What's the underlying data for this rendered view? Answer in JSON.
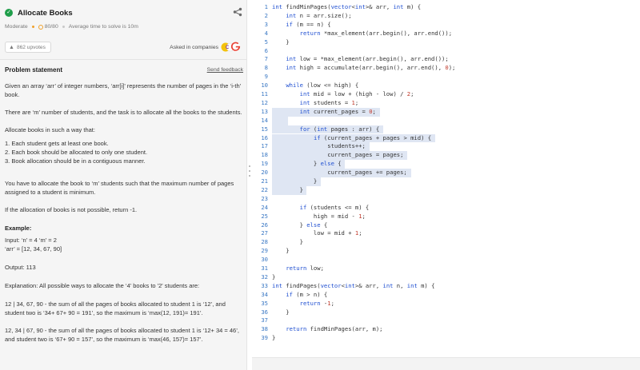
{
  "problem": {
    "title": "Allocate Books",
    "difficulty": "Moderate",
    "score": "80/80",
    "avg_time": "Average time to solve is 10m",
    "upvotes": "862 upvotes",
    "asked_in": "Asked in companies",
    "section_title": "Problem statement",
    "feedback": "Send feedback",
    "statement": [
      "Given an array ‘arr’ of integer numbers, ‘arr[i]’ represents the number of pages in the ‘i-th’ book.",
      "There are ‘m’ number of students, and the task is to allocate all the books to the students.",
      "Allocate books in such a way that:",
      "1. Each student gets at least one book.",
      "2. Each book should be allocated to only one student.",
      "3. Book allocation should be in a contiguous manner.",
      "You have to allocate the book to ‘m’ students such that the maximum number of pages assigned to a student is minimum.",
      "If the allocation of books is not possible, return -1.",
      "Example:",
      "Input: ‘n’ = 4 ‘m’ = 2",
      "‘arr’ = [12, 34, 67, 90]",
      "Output: 113",
      "Explanation: All possible ways to allocate the ‘4’ books to '2' students are:",
      "12 | 34, 67, 90 - the sum of all the pages of books allocated to student 1 is ‘12’, and student two is ‘34+ 67+ 90 = 191’, so the maximum is ‘max(12, 191)= 191’.",
      "12, 34 | 67, 90 - the sum of all the pages of books allocated to student 1 is ‘12+ 34 = 46’, and student two is ‘67+ 90 = 157’, so the maximum is ‘max(46, 157)= 157’."
    ]
  },
  "editor": {
    "lines": [
      "int findMinPages(vector<int>& arr, int m) {",
      "    int n = arr.size();",
      "    if (m == n) {",
      "        return *max_element(arr.begin(), arr.end());",
      "    }",
      "",
      "    int low = *max_element(arr.begin(), arr.end());",
      "    int high = accumulate(arr.begin(), arr.end(), 0);",
      "",
      "    while (low <= high) {",
      "        int mid = low + (high - low) / 2;",
      "        int students = 1;",
      "        int current_pages = 0;",
      "",
      "        for (int pages : arr) {",
      "            if (current_pages + pages > mid) {",
      "                students++;",
      "                current_pages = pages;",
      "            } else {",
      "                current_pages += pages;",
      "            }",
      "        }",
      "",
      "        if (students <= m) {",
      "            high = mid - 1;",
      "        } else {",
      "            low = mid + 1;",
      "        }",
      "    }",
      "",
      "    return low;",
      "}",
      "int findPages(vector<int>& arr, int n, int m) {",
      "    if (m > n) {",
      "        return -1;",
      "    }",
      "",
      "    return findMinPages(arr, m);",
      "}"
    ]
  },
  "colors": {
    "accent": "#1f9e4a",
    "highlight": "#dfe6f3",
    "keyword": "#1f4fd1",
    "line_number": "#3a78c4"
  }
}
